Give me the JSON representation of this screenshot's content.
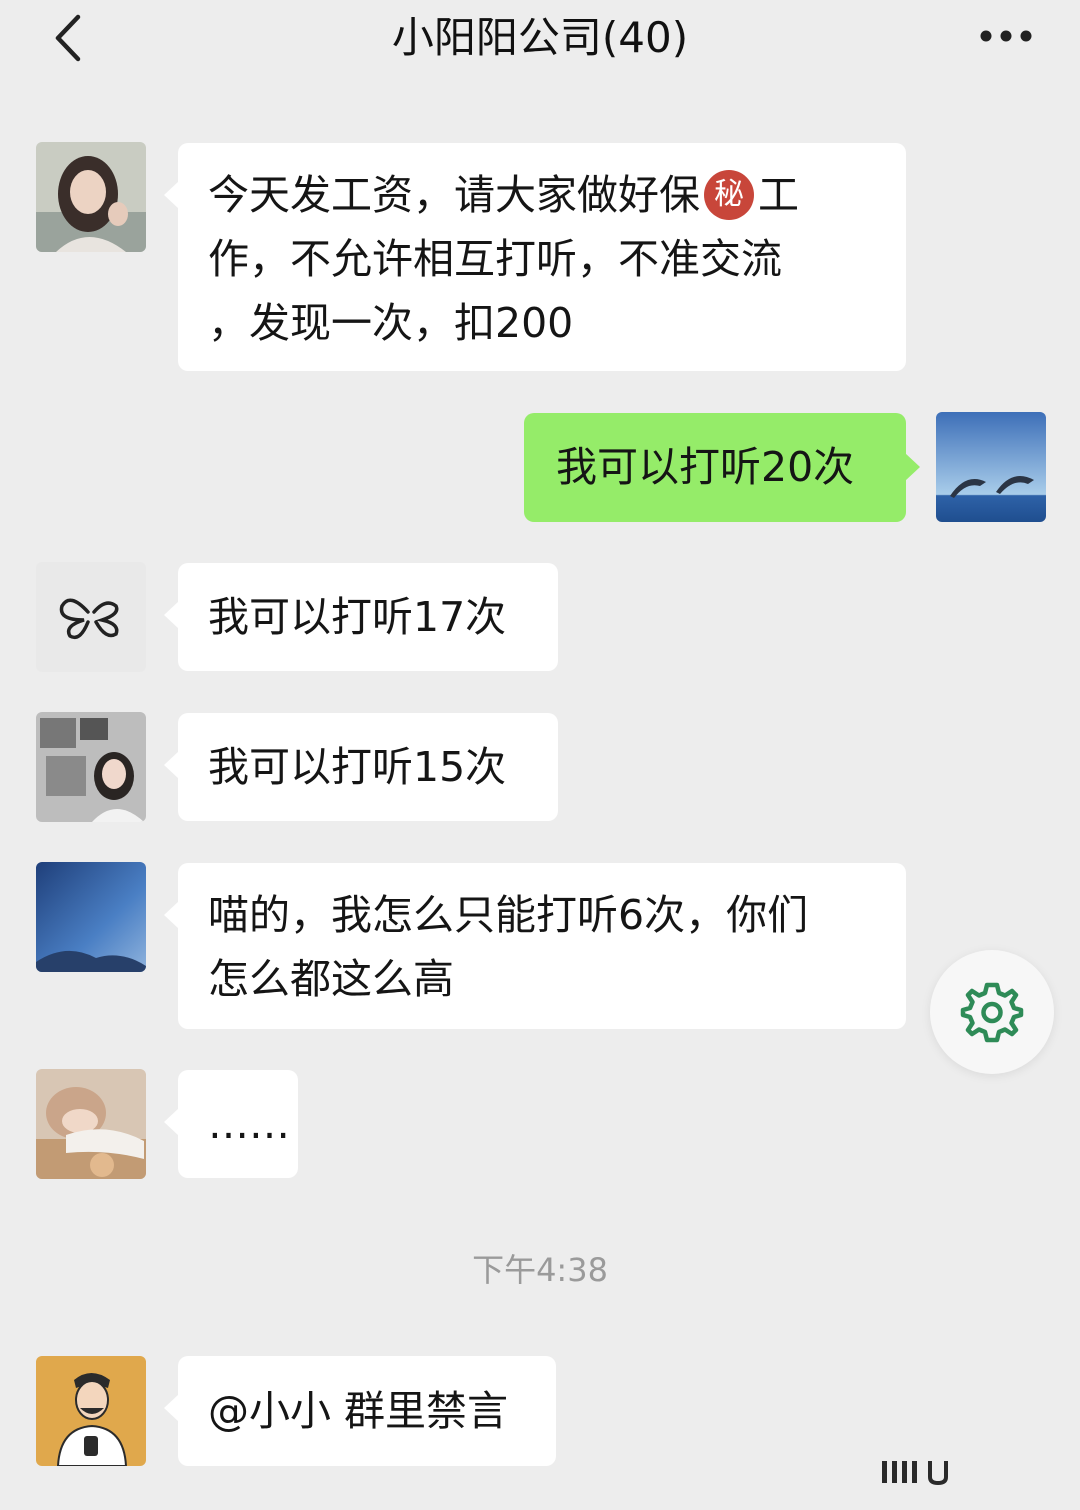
{
  "header": {
    "title": "小阳阳公司(40)",
    "back_icon": "chevron-left-icon",
    "more_icon": "more-dots-icon"
  },
  "messages": [
    {
      "side": "left",
      "avatar": "portrait-avatar",
      "text_parts": [
        "今天发工资，请大家做好保",
        "秘",
        "工",
        "作，不允许相互打听，不准交流",
        "，发现一次，扣200"
      ]
    },
    {
      "side": "right",
      "avatar": "dolphin-avatar",
      "text": "我可以打听20次"
    },
    {
      "side": "left",
      "avatar": "butterfly-avatar",
      "text": "我可以打听17次"
    },
    {
      "side": "left",
      "avatar": "headphone-girl-avatar",
      "text": "我可以打听15次"
    },
    {
      "side": "left",
      "avatar": "sky-avatar",
      "text_lines": [
        "喵的，我怎么只能打听6次，你们",
        "怎么都这么高"
      ]
    },
    {
      "side": "left",
      "avatar": "sleeping-person-avatar",
      "text": "……"
    },
    {
      "side": "left",
      "avatar": "cartoon-man-avatar",
      "text": "@小小 群里禁言"
    }
  ],
  "timestamp": "下午4:38",
  "colors": {
    "background": "#ededed",
    "bubble_left": "#ffffff",
    "bubble_right": "#95ec69",
    "secret_badge": "#c8463a",
    "gear": "#2e8b57"
  },
  "floating_button_icon": "gear-icon"
}
